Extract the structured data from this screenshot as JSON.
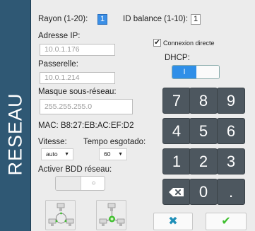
{
  "side_title": "RESEAU",
  "rayon": {
    "label": "Rayon (1-20):",
    "value": "1"
  },
  "balance": {
    "label": "ID balance (1-10):",
    "value": "1"
  },
  "ip": {
    "label": "Adresse IP:",
    "value": "10.0.1.176"
  },
  "gateway": {
    "label": "Passerelle:",
    "value": "10.0.1.214"
  },
  "mask": {
    "label": "Masque sous-réseau:",
    "value": "255.255.255.0"
  },
  "mac": {
    "text": "MAC: B8:27:EB:AC:EF:D2"
  },
  "direct_connection": {
    "label": "Connexion directe",
    "checked": true,
    "check_glyph": "✔"
  },
  "dhcp": {
    "label": "DHCP:",
    "on_label": "I"
  },
  "speed": {
    "label": "Vitesse:",
    "value": "auto",
    "caret": "▼"
  },
  "timeout": {
    "label": "Tempo esgotado:",
    "value": "60",
    "caret": "▼"
  },
  "bdd": {
    "label": "Activer BDD réseau:",
    "off_symbol": "○"
  },
  "keypad": {
    "keys": [
      "7",
      "8",
      "9",
      "4",
      "5",
      "6",
      "1",
      "2",
      "3"
    ],
    "zero": "0",
    "dot": ".",
    "backspace_icon": "backspace-icon"
  },
  "actions": {
    "cancel_symbol": "✖",
    "confirm_symbol": "✔"
  },
  "colors": {
    "sidebar": "#2f5874",
    "keypad": "#4d575f",
    "accent": "#2f8fe8",
    "cancel": "#1f8fb8",
    "confirm": "#3fbf2f"
  }
}
